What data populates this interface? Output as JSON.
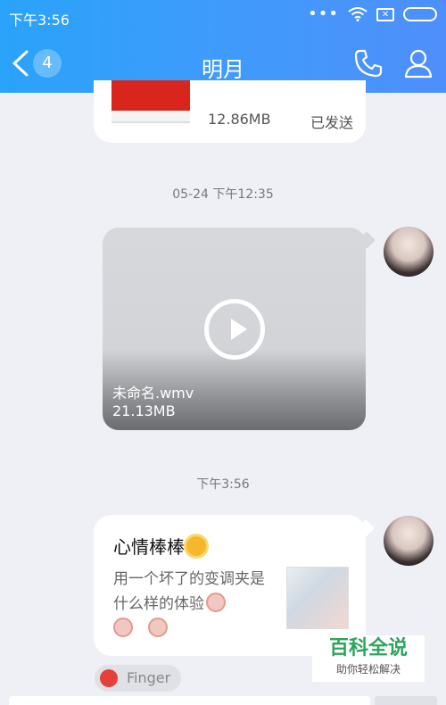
{
  "status_bar": {
    "time": "下午3:56",
    "dots": "•••"
  },
  "header": {
    "back_badge": "4",
    "title": "明月"
  },
  "file_message": {
    "size": "12.86MB",
    "status": "已发送"
  },
  "timestamps": [
    "05-24 下午12:35",
    "下午3:56"
  ],
  "video_message": {
    "filename": "未命名.wmv",
    "size": "21.13MB"
  },
  "text_message": {
    "title": "心情棒棒",
    "description": "用一个坏了的变调夹是什么样的体验"
  },
  "finger_tag": "Finger",
  "watermark": {
    "line1": "百科全说",
    "line2": "助你轻松解决"
  },
  "colors": {
    "header_gradient_start": "#2aa3fa",
    "header_gradient_end": "#4f8ffb",
    "background": "#eef0f5"
  }
}
